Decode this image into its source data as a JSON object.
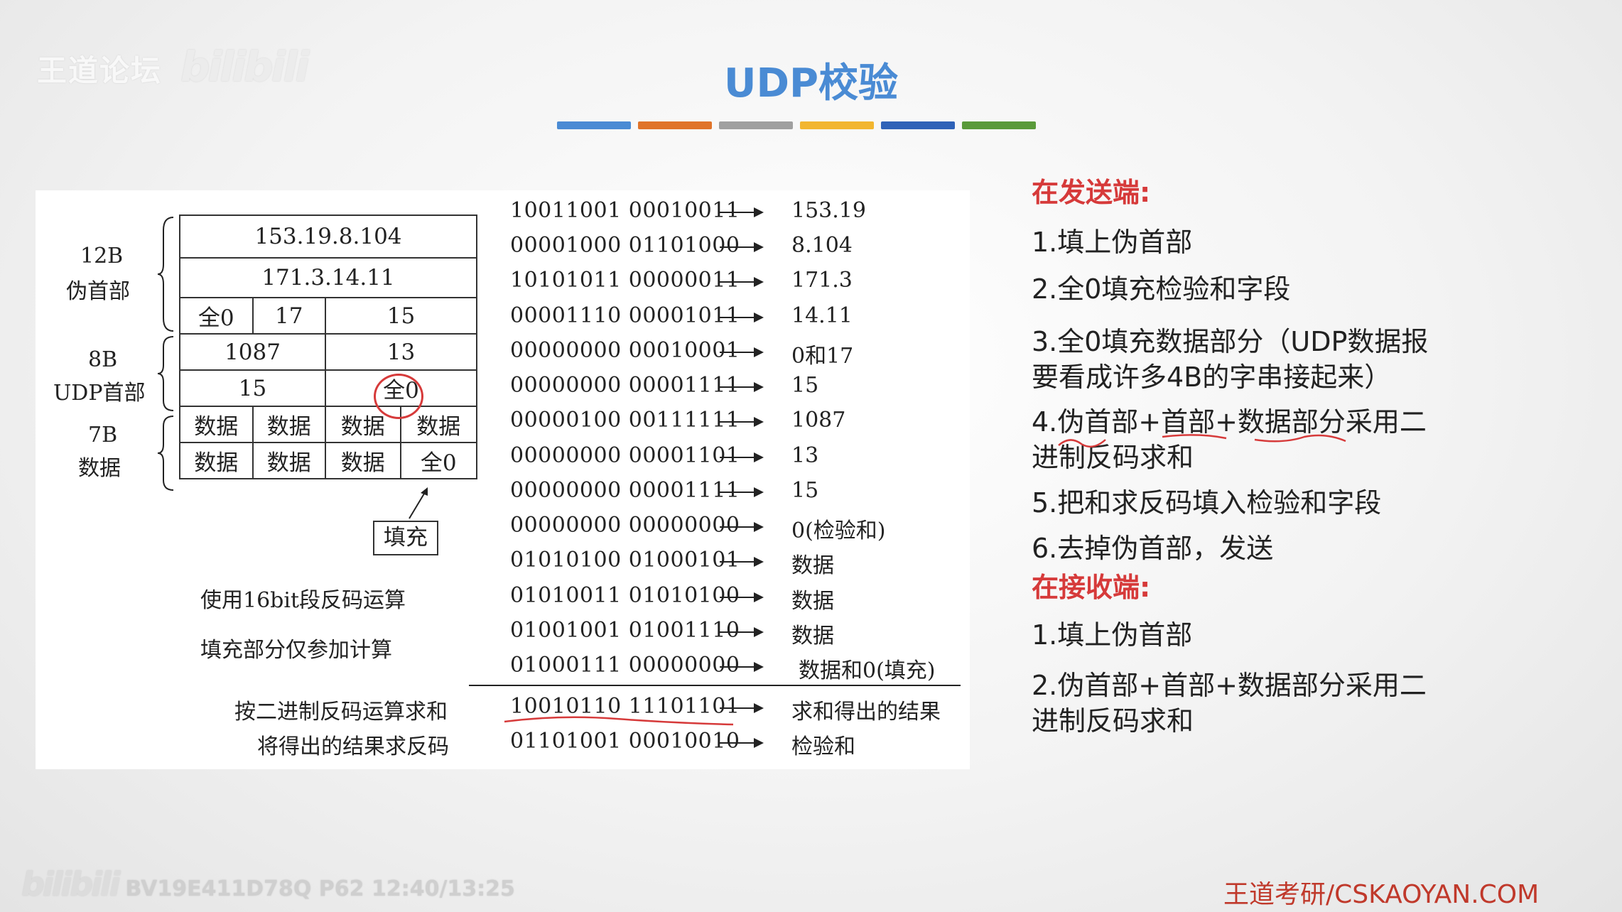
{
  "watermark": {
    "site": "王道论坛",
    "bili": "bilibili",
    "bottom_bili": "bilibili",
    "video_info": "BV19E411D78Q P62 12:40/13:25"
  },
  "title": "UDP校验",
  "colorbar": [
    "#4a8bd4",
    "#e0742a",
    "#a0a0a0",
    "#f2b630",
    "#2f62b8",
    "#5a9a3a"
  ],
  "figure": {
    "labels": {
      "pseudo_size": "12B",
      "pseudo_name": "伪首部",
      "udp_size": "8B",
      "udp_name": "UDP首部",
      "data_size": "7B",
      "data_name": "数据"
    },
    "rows": {
      "r1": "153.19.8.104",
      "r2": "171.3.14.11",
      "r3": [
        "全0",
        "17",
        "15"
      ],
      "r4": [
        "1087",
        "13"
      ],
      "r5": [
        "15",
        "全0"
      ],
      "r6": [
        "数据",
        "数据",
        "数据",
        "数据"
      ],
      "r7": [
        "数据",
        "数据",
        "数据",
        "全0"
      ]
    },
    "fill_label": "填充",
    "note1": "使用16bit段反码运算",
    "note2": "填充部分仅参加计算",
    "note3": "按二进制反码运算求和",
    "note4": "将得出的结果求反码",
    "binary": [
      {
        "bits": "10011001 00010011",
        "value": "153.19"
      },
      {
        "bits": "00001000 01101000",
        "value": "8.104"
      },
      {
        "bits": "10101011 00000011",
        "value": "171.3"
      },
      {
        "bits": "00001110 00001011",
        "value": "14.11"
      },
      {
        "bits": "00000000 00010001",
        "value": "0和17"
      },
      {
        "bits": "00000000 00001111",
        "value": "15"
      },
      {
        "bits": "00000100 00111111",
        "value": "1087"
      },
      {
        "bits": "00000000 00001101",
        "value": "13"
      },
      {
        "bits": "00000000 00001111",
        "value": "15"
      },
      {
        "bits": "00000000 00000000",
        "value": "0(检验和)"
      },
      {
        "bits": "01010100 01000101",
        "value": "数据"
      },
      {
        "bits": "01010011 01010100",
        "value": "数据"
      },
      {
        "bits": "01001001 01001110",
        "value": "数据"
      },
      {
        "bits": "01000111 00000000",
        "value": "数据和0(填充)"
      }
    ],
    "sum": {
      "bits": "10010110 11101101",
      "value": "求和得出的结果"
    },
    "checksum": {
      "bits": "01101001 00010010",
      "value": "检验和"
    }
  },
  "sender": {
    "heading": "在发送端:",
    "steps": [
      "1.填上伪首部",
      "2.全0填充检验和字段",
      "3.全0填充数据部分（UDP数据报",
      "要看成许多4B的字串接起来）",
      "4.伪首部+首部+数据部分采用二",
      "进制反码求和",
      "5.把和求反码填入检验和字段",
      "6.去掉伪首部，发送"
    ]
  },
  "receiver": {
    "heading": "在接收端:",
    "steps": [
      "1.填上伪首部",
      "2.伪首部+首部+数据部分采用二",
      "进制反码求和"
    ]
  },
  "footer": "王道考研/CSKAOYAN.COM"
}
